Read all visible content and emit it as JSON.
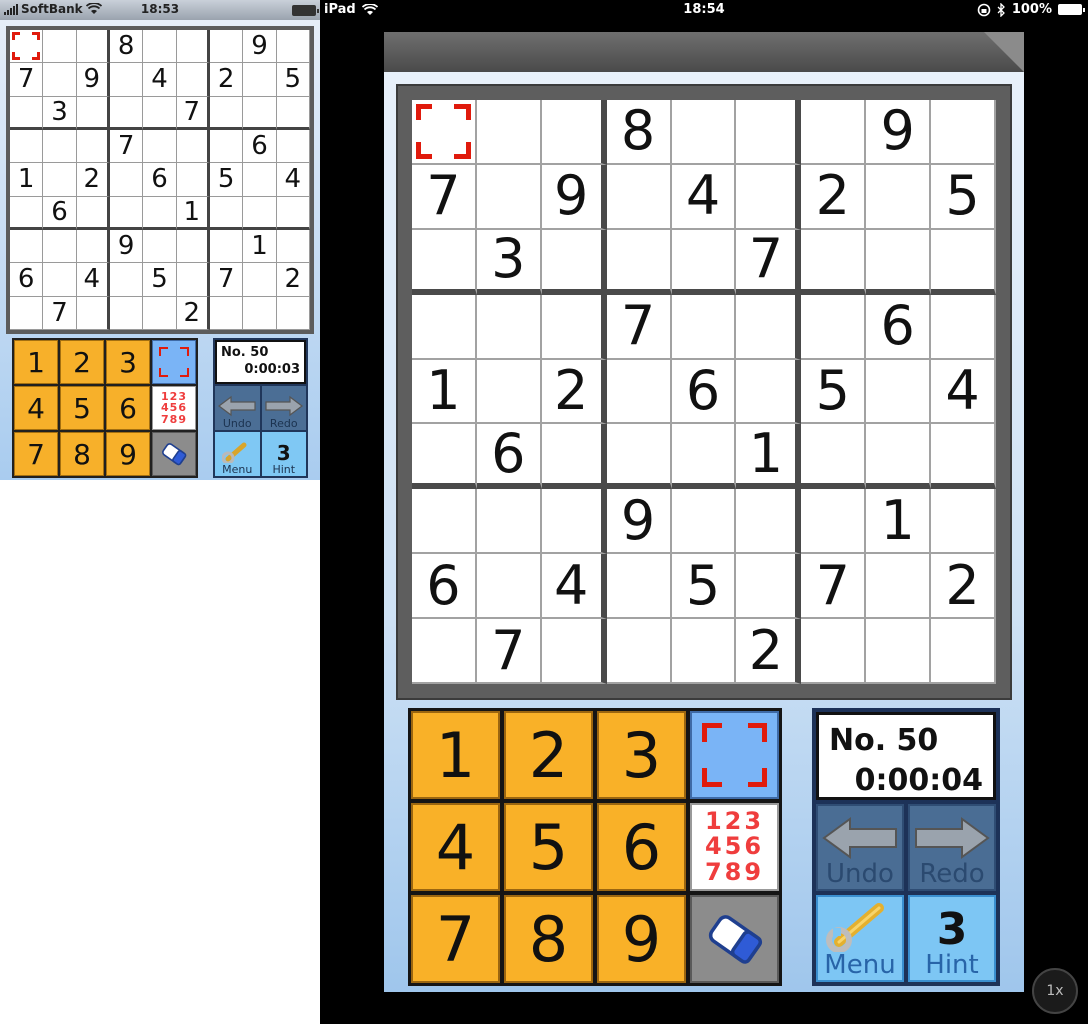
{
  "iphone": {
    "status": {
      "carrier": "SoftBank",
      "time": "18:53"
    },
    "puzzle_no": "No. 50",
    "timer": "0:00:03",
    "undo": "Undo",
    "redo": "Redo",
    "menu": "Menu",
    "hint": "Hint",
    "hint_count": "3"
  },
  "ipad": {
    "status": {
      "device": "iPad",
      "time": "18:54",
      "battery": "100%"
    },
    "puzzle_no": "No. 50",
    "timer": "0:00:04",
    "undo": "Undo",
    "redo": "Redo",
    "menu": "Menu",
    "hint": "Hint",
    "hint_count": "3",
    "zoom": "1x"
  },
  "board": [
    [
      "",
      "",
      "",
      "8",
      "",
      "",
      "",
      "9",
      ""
    ],
    [
      "7",
      "",
      "9",
      "",
      "4",
      "",
      "2",
      "",
      "5"
    ],
    [
      "",
      "3",
      "",
      "",
      "",
      "7",
      "",
      "",
      ""
    ],
    [
      "",
      "",
      "",
      "7",
      "",
      "",
      "",
      "6",
      ""
    ],
    [
      "1",
      "",
      "2",
      "",
      "6",
      "",
      "5",
      "",
      "4"
    ],
    [
      "",
      "6",
      "",
      "",
      "",
      "1",
      "",
      "",
      ""
    ],
    [
      "",
      "",
      "",
      "9",
      "",
      "",
      "",
      "1",
      ""
    ],
    [
      "6",
      "",
      "4",
      "",
      "5",
      "",
      "7",
      "",
      "2"
    ],
    [
      "",
      "7",
      "",
      "",
      "",
      "2",
      "",
      "",
      ""
    ]
  ],
  "selected_cell": {
    "row": 0,
    "col": 0
  },
  "keypad": {
    "digits": [
      "1",
      "2",
      "3",
      "4",
      "5",
      "6",
      "7",
      "8",
      "9"
    ],
    "memo_lines": [
      "123",
      "456",
      "789"
    ],
    "eraser_label": "Eraser"
  },
  "colors": {
    "key": "#f9b128",
    "cursor": "#e01a0c",
    "memo": "#ef3d3d",
    "panel": "#1d3258"
  }
}
